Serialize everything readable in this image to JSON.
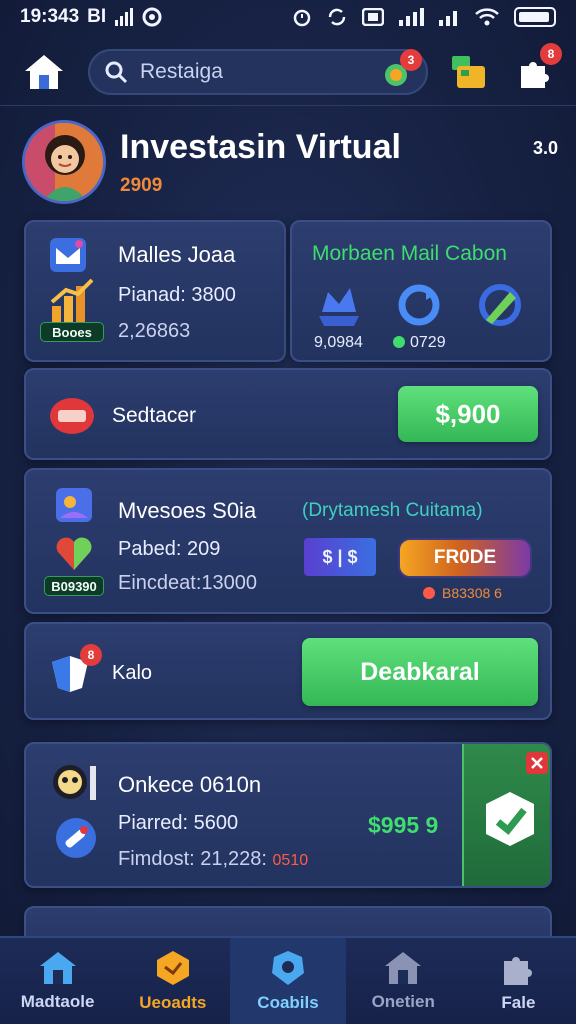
{
  "status_bar": {
    "time": "19:343",
    "carrier": "BI"
  },
  "search": {
    "placeholder": "Restaiga",
    "chip_badge": "3"
  },
  "header": {
    "notification_badge": "8"
  },
  "profile": {
    "name": "Investasin Virtual",
    "subtitle": "2909",
    "right_value": "3.0"
  },
  "card1": {
    "title": "Malles Joaa",
    "line1": "Pianad: 3800",
    "line2": "2,26863",
    "pill": "Booes"
  },
  "card2": {
    "title": "Morbaen Mail Cabon",
    "stat1": "9,0984",
    "stat2": "0729"
  },
  "card3": {
    "label": "Sedtacer",
    "button": "$,900"
  },
  "card4": {
    "title": "Mvesoes S0ia",
    "line1": "Pabed: 209",
    "line2": "Eincdeat:13000",
    "pill": "B09390",
    "right_title": "(Drytamesh Cuitama)",
    "tag": "$ | $",
    "button": "FR0DE",
    "footnote": "B83308 6"
  },
  "card5": {
    "label": "Kalo",
    "icon_badge": "8",
    "button": "Deabkaral"
  },
  "card6": {
    "title": "Onkece 0610n",
    "line1": "Piarred: 5600",
    "line2_prefix": "Fimdost: 21,228:",
    "line2_suffix": "0510",
    "amount": "$995 9"
  },
  "bottom_nav": {
    "items": [
      {
        "label": "Madtaole",
        "icon": "house-icon"
      },
      {
        "label": "Ueoadts",
        "icon": "hexagon-icon"
      },
      {
        "label": "Coabils",
        "icon": "badge-icon"
      },
      {
        "label": "Onetien",
        "icon": "house-icon"
      },
      {
        "label": "Fale",
        "icon": "puzzle-icon"
      }
    ]
  },
  "colors": {
    "green": "#3fdc6e",
    "orange": "#f08a3a",
    "red": "#e23c3c",
    "accent": "#7fd0ff"
  }
}
